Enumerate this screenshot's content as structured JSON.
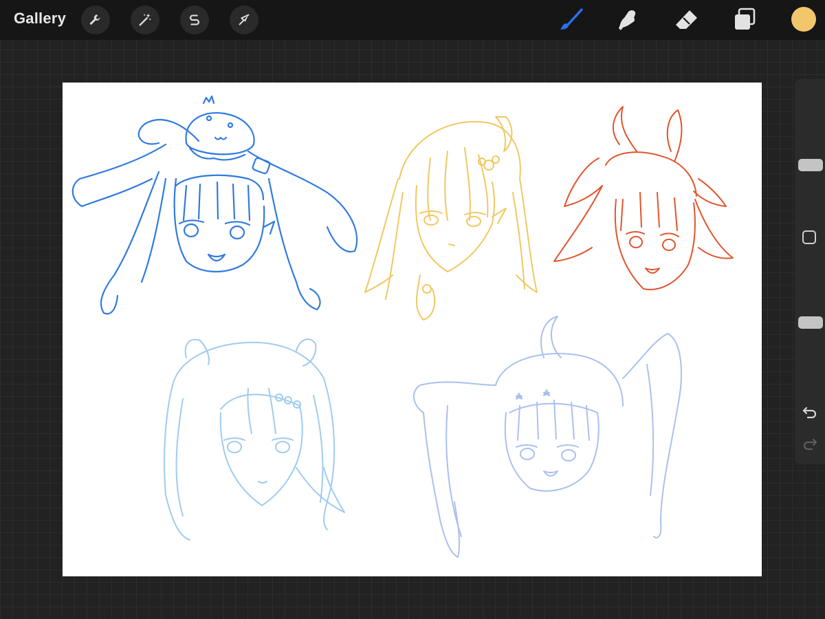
{
  "app": {
    "gallery_label": "Gallery"
  },
  "toolbar": {
    "left_tools": [
      {
        "name": "actions",
        "icon": "wrench-icon"
      },
      {
        "name": "adjustments",
        "icon": "magic-wand-icon"
      },
      {
        "name": "selection",
        "icon": "selection-s-icon"
      },
      {
        "name": "transform",
        "icon": "arrow-cursor-icon"
      }
    ],
    "right_tools": [
      {
        "name": "brush",
        "icon": "brush-icon",
        "active": true
      },
      {
        "name": "smudge",
        "icon": "smudge-finger-icon",
        "active": false
      },
      {
        "name": "eraser",
        "icon": "eraser-icon",
        "active": false
      },
      {
        "name": "layers",
        "icon": "layers-icon",
        "active": false
      }
    ],
    "current_color": "#f2c76b",
    "active_color": "#2b6ff2",
    "inactive_color": "#e2e2e2"
  },
  "sidebar": {
    "brush_size_level": 0.3,
    "opacity_level": 0.52,
    "modify_icon": "square-outline-icon",
    "undo_icon": "undo-arrow-icon",
    "redo_icon": "redo-arrow-icon"
  },
  "canvas": {
    "background": "#ffffff",
    "sketch_colors": [
      "#2f7ae0",
      "#f0c860",
      "#e0542c",
      "#9fcbf0",
      "#a9c0ee"
    ]
  }
}
